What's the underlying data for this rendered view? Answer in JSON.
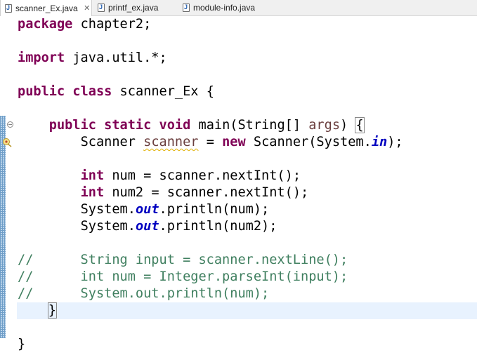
{
  "tabs": [
    {
      "label": "scanner_Ex.java",
      "active": true,
      "close": "✕"
    },
    {
      "label": "printf_ex.java",
      "active": false
    },
    {
      "label": "module-info.java",
      "active": false
    }
  ],
  "colors": {
    "keyword": "#7f0055",
    "comment": "#3f7f5f",
    "field": "#0000c0",
    "local_var": "#6a3e3e",
    "current_line": "#e8f2fe"
  },
  "code": {
    "l1": {
      "kw": "package",
      "rest": " chapter2;"
    },
    "l3": {
      "kw": "import",
      "rest": " java.util.*;"
    },
    "l5": {
      "kw1": "public",
      "kw2": "class",
      "rest": " scanner_Ex {"
    },
    "l7": {
      "indent": "    ",
      "kw1": "public",
      "kw2": "static",
      "kw3": "void",
      "mid": " main(String[] ",
      "param": "args",
      "close": ") ",
      "brace": "{"
    },
    "l8": {
      "indent": "        ",
      "a": "Scanner ",
      "var": "scanner",
      "b": " = ",
      "kw": "new",
      "c": " Scanner(System.",
      "field": "in",
      "d": ");"
    },
    "l10": {
      "indent": "        ",
      "kw": "int",
      "rest": " num = scanner.nextInt();"
    },
    "l11": {
      "indent": "        ",
      "kw": "int",
      "rest": " num2 = scanner.nextInt();"
    },
    "l12": {
      "indent": "        ",
      "a": "System.",
      "field": "out",
      "b": ".println(num);"
    },
    "l13": {
      "indent": "        ",
      "a": "System.",
      "field": "out",
      "b": ".println(num2);"
    },
    "l15": {
      "text": "//      String input = scanner.nextLine();"
    },
    "l16": {
      "text": "//      int num = Integer.parseInt(input);"
    },
    "l17": {
      "text": "//      System.out.println(num);"
    },
    "l18": {
      "indent": "    ",
      "brace": "}"
    },
    "l20": {
      "text": "}"
    }
  }
}
